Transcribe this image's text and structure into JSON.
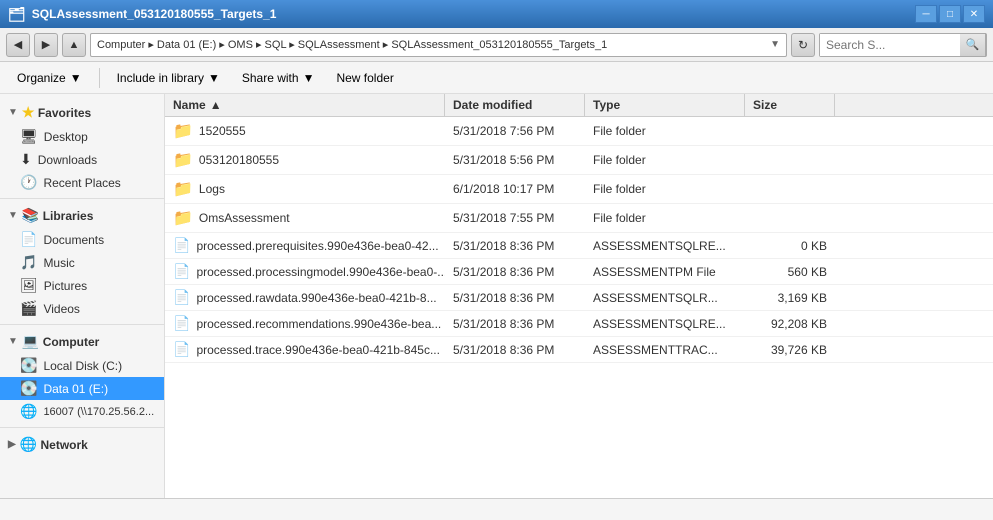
{
  "titleBar": {
    "title": "SQLAssessment_053120180555_Targets_1",
    "icon": "🗂"
  },
  "addressBar": {
    "path": "Computer ▸ Data 01 (E:) ▸ OMS ▸ SQL ▸ SQLAssessment ▸ SQLAssessment_053120180555_Targets_1",
    "searchPlaceholder": "Search S...",
    "searchLabel": "Search"
  },
  "toolbar": {
    "organize": "Organize",
    "includeInLibrary": "Include in library",
    "shareWith": "Share with",
    "newFolder": "New folder"
  },
  "sidebar": {
    "favorites": {
      "header": "Favorites",
      "items": [
        {
          "label": "Desktop",
          "icon": "🖥"
        },
        {
          "label": "Downloads",
          "icon": "⬇"
        },
        {
          "label": "Recent Places",
          "icon": "🕐"
        }
      ]
    },
    "libraries": {
      "header": "Libraries",
      "items": [
        {
          "label": "Documents",
          "icon": "📄"
        },
        {
          "label": "Music",
          "icon": "🎵"
        },
        {
          "label": "Pictures",
          "icon": "🖼"
        },
        {
          "label": "Videos",
          "icon": "🎬"
        }
      ]
    },
    "computer": {
      "header": "Computer",
      "items": [
        {
          "label": "Local Disk (C:)",
          "icon": "💽"
        },
        {
          "label": "Data 01 (E:)",
          "icon": "💽",
          "selected": true
        },
        {
          "label": "16007 (\\\\170.25.56.2...",
          "icon": "🌐"
        }
      ]
    },
    "network": {
      "header": "Network"
    }
  },
  "columns": {
    "name": "Name",
    "dateMod": "Date modified",
    "type": "Type",
    "size": "Size"
  },
  "files": [
    {
      "name": "1520555",
      "date": "5/31/2018 7:56 PM",
      "type": "File folder",
      "size": "",
      "isFolder": true
    },
    {
      "name": "053120180555",
      "date": "5/31/2018 5:56 PM",
      "type": "File folder",
      "size": "",
      "isFolder": true
    },
    {
      "name": "Logs",
      "date": "6/1/2018 10:17 PM",
      "type": "File folder",
      "size": "",
      "isFolder": true
    },
    {
      "name": "OmsAssessment",
      "date": "5/31/2018 7:55 PM",
      "type": "File folder",
      "size": "",
      "isFolder": true
    },
    {
      "name": "processed.prerequisites.990e436e-bea0-42...",
      "date": "5/31/2018 8:36 PM",
      "type": "ASSESSMENTSQLRE...",
      "size": "0 KB",
      "isFolder": false
    },
    {
      "name": "processed.processingmodel.990e436e-bea0-...",
      "date": "5/31/2018 8:36 PM",
      "type": "ASSESSMENTPM File",
      "size": "560 KB",
      "isFolder": false
    },
    {
      "name": "processed.rawdata.990e436e-bea0-421b-8...",
      "date": "5/31/2018 8:36 PM",
      "type": "ASSESSMENTSQLR...",
      "size": "3,169 KB",
      "isFolder": false
    },
    {
      "name": "processed.recommendations.990e436e-bea...",
      "date": "5/31/2018 8:36 PM",
      "type": "ASSESSMENTSQLRE...",
      "size": "92,208 KB",
      "isFolder": false
    },
    {
      "name": "processed.trace.990e436e-bea0-421b-845c...",
      "date": "5/31/2018 8:36 PM",
      "type": "ASSESSMENTTRAC...",
      "size": "39,726 KB",
      "isFolder": false
    }
  ],
  "statusBar": {
    "text": ""
  }
}
